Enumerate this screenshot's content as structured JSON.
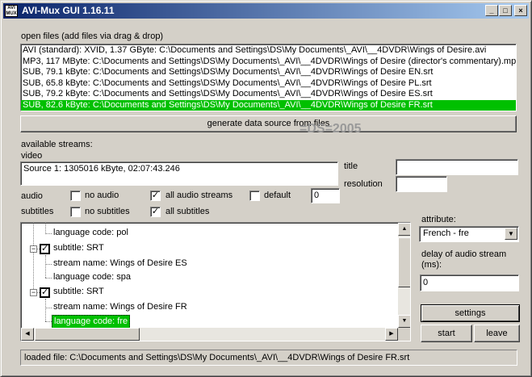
{
  "window": {
    "title": "AVI-Mux GUI 1.16.11",
    "app_icon_text": "AVI MUX GUI",
    "min_glyph": "_",
    "max_glyph": "□",
    "close_glyph": "×"
  },
  "open_files": {
    "label": "open files (add files via drag & drop)",
    "items": [
      {
        "text": "AVI (standard): XVID, 1.37 GByte: C:\\Documents and Settings\\DS\\My Documents\\_AVI\\__4DVDR\\Wings of Desire.avi",
        "selected": false
      },
      {
        "text": "MP3, 117 MByte: C:\\Documents and Settings\\DS\\My Documents\\_AVI\\__4DVDR\\Wings of Desire (director's commentary).mp3",
        "selected": false
      },
      {
        "text": "SUB, 79.1 kByte: C:\\Documents and Settings\\DS\\My Documents\\_AVI\\__4DVDR\\Wings of Desire EN.srt",
        "selected": false
      },
      {
        "text": "SUB, 65.8 kByte: C:\\Documents and Settings\\DS\\My Documents\\_AVI\\__4DVDR\\Wings of Desire PL.srt",
        "selected": false
      },
      {
        "text": "SUB, 79.2 kByte: C:\\Documents and Settings\\DS\\My Documents\\_AVI\\__4DVDR\\Wings of Desire ES.srt",
        "selected": false
      },
      {
        "text": "SUB, 82.6 kByte: C:\\Documents and Settings\\DS\\My Documents\\_AVI\\__4DVDR\\Wings of Desire FR.srt",
        "selected": true
      }
    ]
  },
  "generate_button": "generate data source from files",
  "watermark": "=DS=2005",
  "streams": {
    "available_label": "available streams:",
    "video_label": "video",
    "video_source": "Source 1: 1305016 kByte, 02:07:43.246",
    "title_label": "title",
    "title_value": "",
    "resolution_label": "resolution",
    "resolution_value": ""
  },
  "audio": {
    "label": "audio",
    "no_audio": {
      "label": "no audio",
      "checked": false
    },
    "all_audio": {
      "label": "all audio streams",
      "checked": true
    },
    "default": {
      "label": "default",
      "checked": false
    },
    "default_value": "0"
  },
  "subtitles": {
    "label": "subtitles",
    "no_subtitles": {
      "label": "no subtitles",
      "checked": false
    },
    "all_subtitles": {
      "label": "all subtitles",
      "checked": true
    }
  },
  "tree": {
    "nodes": [
      {
        "text": "language code: pol",
        "kind": "leaf"
      },
      {
        "text": "subtitle: SRT",
        "kind": "parent"
      },
      {
        "text": "stream name: Wings of Desire ES",
        "kind": "leaf"
      },
      {
        "text": "language code: spa",
        "kind": "leaf"
      },
      {
        "text": "subtitle: SRT",
        "kind": "parent"
      },
      {
        "text": "stream name: Wings of Desire FR",
        "kind": "leaf"
      },
      {
        "text": "language code: fre",
        "kind": "leaf",
        "selected": true
      }
    ],
    "check_glyph": "✓",
    "expander_glyph": "−"
  },
  "attribute": {
    "label": "attribute:",
    "selected": "French - fre"
  },
  "delay": {
    "label_line1": "delay of audio stream",
    "label_line2": "(ms):",
    "value": "0"
  },
  "buttons": {
    "settings": "settings",
    "start": "start",
    "leave": "leave"
  },
  "status": "loaded file: C:\\Documents and Settings\\DS\\My Documents\\_AVI\\__4DVDR\\Wings of Desire FR.srt",
  "icons": {
    "scroll_up": "▲",
    "scroll_down": "▼",
    "scroll_left": "◀",
    "scroll_right": "▶",
    "combo_arrow": "▼"
  }
}
